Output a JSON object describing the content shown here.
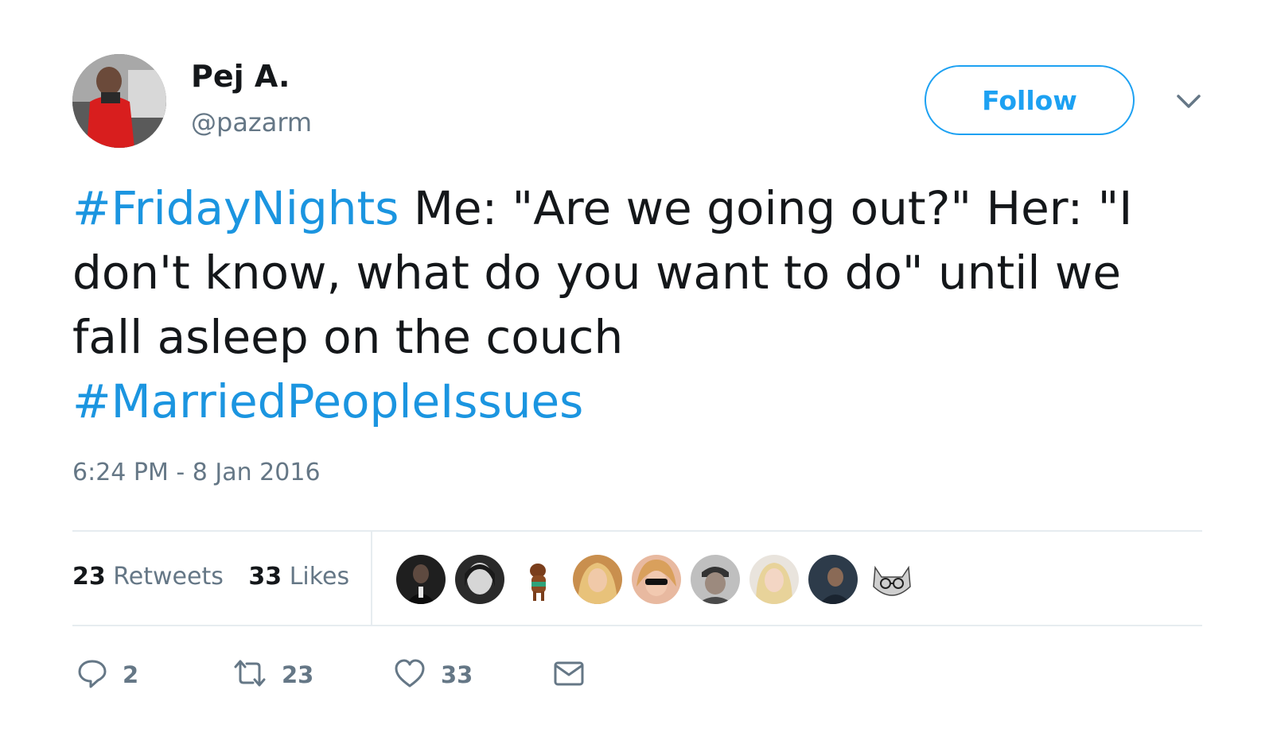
{
  "author": {
    "display_name": "Pej A.",
    "handle": "@pazarm"
  },
  "follow_button": {
    "label": "Follow"
  },
  "tweet": {
    "lines": [
      [
        {
          "text": "#FridayNights",
          "type": "hashtag"
        },
        {
          "text": " Me: \"Are we going out?\" Her: \"I",
          "type": "text"
        }
      ],
      [
        {
          "text": "don't know, what do you want to do\" until we",
          "type": "text"
        }
      ],
      [
        {
          "text": "fall asleep on the couch",
          "type": "text"
        }
      ],
      [
        {
          "text": "#MarriedPeopleIssues",
          "type": "hashtag"
        }
      ]
    ],
    "timestamp": "6:24 PM - 8 Jan 2016"
  },
  "stats": {
    "retweets_count": "23",
    "retweets_label": "Retweets",
    "likes_count": "33",
    "likes_label": "Likes"
  },
  "likers": [
    {
      "icon": "liker-avatar-1",
      "bg": "#1f1f1f"
    },
    {
      "icon": "liker-avatar-2",
      "bg": "#3a3a3a"
    },
    {
      "icon": "liker-avatar-3",
      "bg": "#ffffff"
    },
    {
      "icon": "liker-avatar-4",
      "bg": "#d9a566"
    },
    {
      "icon": "liker-avatar-5",
      "bg": "#e8b9a0"
    },
    {
      "icon": "liker-avatar-6",
      "bg": "#8a8a8a"
    },
    {
      "icon": "liker-avatar-7",
      "bg": "#e9d3c4"
    },
    {
      "icon": "liker-avatar-8",
      "bg": "#3c4a5a"
    },
    {
      "icon": "liker-avatar-9",
      "bg": "#ffffff"
    }
  ],
  "actions": {
    "reply_count": "2",
    "retweet_count": "23",
    "like_count": "33"
  },
  "colors": {
    "accent": "#1da1f2",
    "hashtag": "#1b95e0",
    "muted": "#657786",
    "text": "#14171a",
    "divider": "#e6ecf0"
  }
}
